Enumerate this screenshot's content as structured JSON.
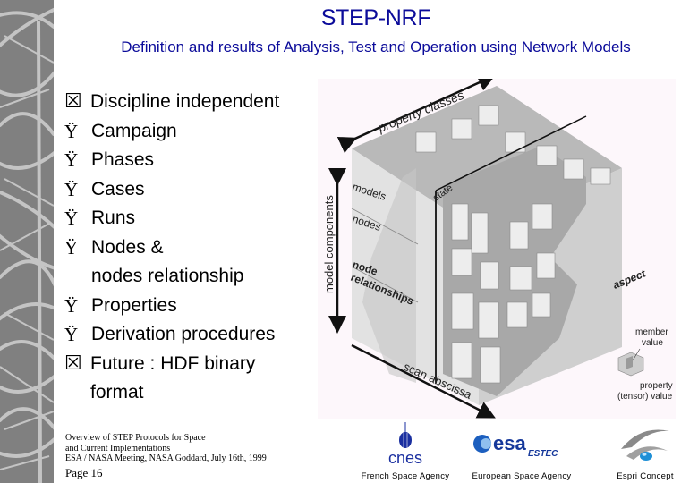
{
  "header": {
    "title": "STEP-NRF",
    "subtitle": "Definition and results of Analysis, Test and Operation using Network Models"
  },
  "bullets": [
    {
      "marker": "box-icon",
      "glyph": "☒",
      "text": "Discipline independent"
    },
    {
      "marker": "y-diaeresis-bullet",
      "glyph": "Ÿ",
      "text": "Campaign"
    },
    {
      "marker": "y-diaeresis-bullet",
      "glyph": "Ÿ",
      "text": "Phases"
    },
    {
      "marker": "y-diaeresis-bullet",
      "glyph": "Ÿ",
      "text": "Cases"
    },
    {
      "marker": "y-diaeresis-bullet",
      "glyph": "Ÿ",
      "text": "Runs"
    },
    {
      "marker": "y-diaeresis-bullet",
      "glyph": "Ÿ",
      "text": "Nodes &\nnodes relationship"
    },
    {
      "marker": "y-diaeresis-bullet",
      "glyph": "Ÿ",
      "text": "Properties"
    },
    {
      "marker": "y-diaeresis-bullet",
      "glyph": "Ÿ",
      "text": "Derivation procedures"
    },
    {
      "marker": "box-icon",
      "glyph": "☒",
      "text": "Future : HDF binary\nformat"
    }
  ],
  "diagram": {
    "axis_property_classes": "property classes",
    "axis_model_components": "model components",
    "axis_scan_abscissa": "scan abscissa",
    "label_models": "models",
    "label_nodes": "nodes",
    "label_node": "node",
    "label_relationships": "relationships",
    "label_state": "state",
    "label_aspect": "aspect",
    "legend_member": "member",
    "legend_value": "value",
    "legend_property": "property",
    "legend_tensor_value": "(tensor) value"
  },
  "footer": {
    "line1": "Overview of STEP Protocols for Space",
    "line2": "and Current Implementations",
    "line3": "ESA / NASA Meeting, NASA Goddard, July 16th, 1999",
    "page": "Page 16"
  },
  "logos": [
    {
      "name": "cnes",
      "wordmark": "cnes",
      "caption": "French Space Agency"
    },
    {
      "name": "esa",
      "wordmark": "esa",
      "sub": "ESTEC",
      "caption": "European Space Agency"
    },
    {
      "name": "espri",
      "caption": "Espri Concept"
    }
  ],
  "colors": {
    "title": "#0b0b9a",
    "strip": "#808080",
    "cnes_blue": "#1a2fa0",
    "esa_blue": "#14379a"
  }
}
